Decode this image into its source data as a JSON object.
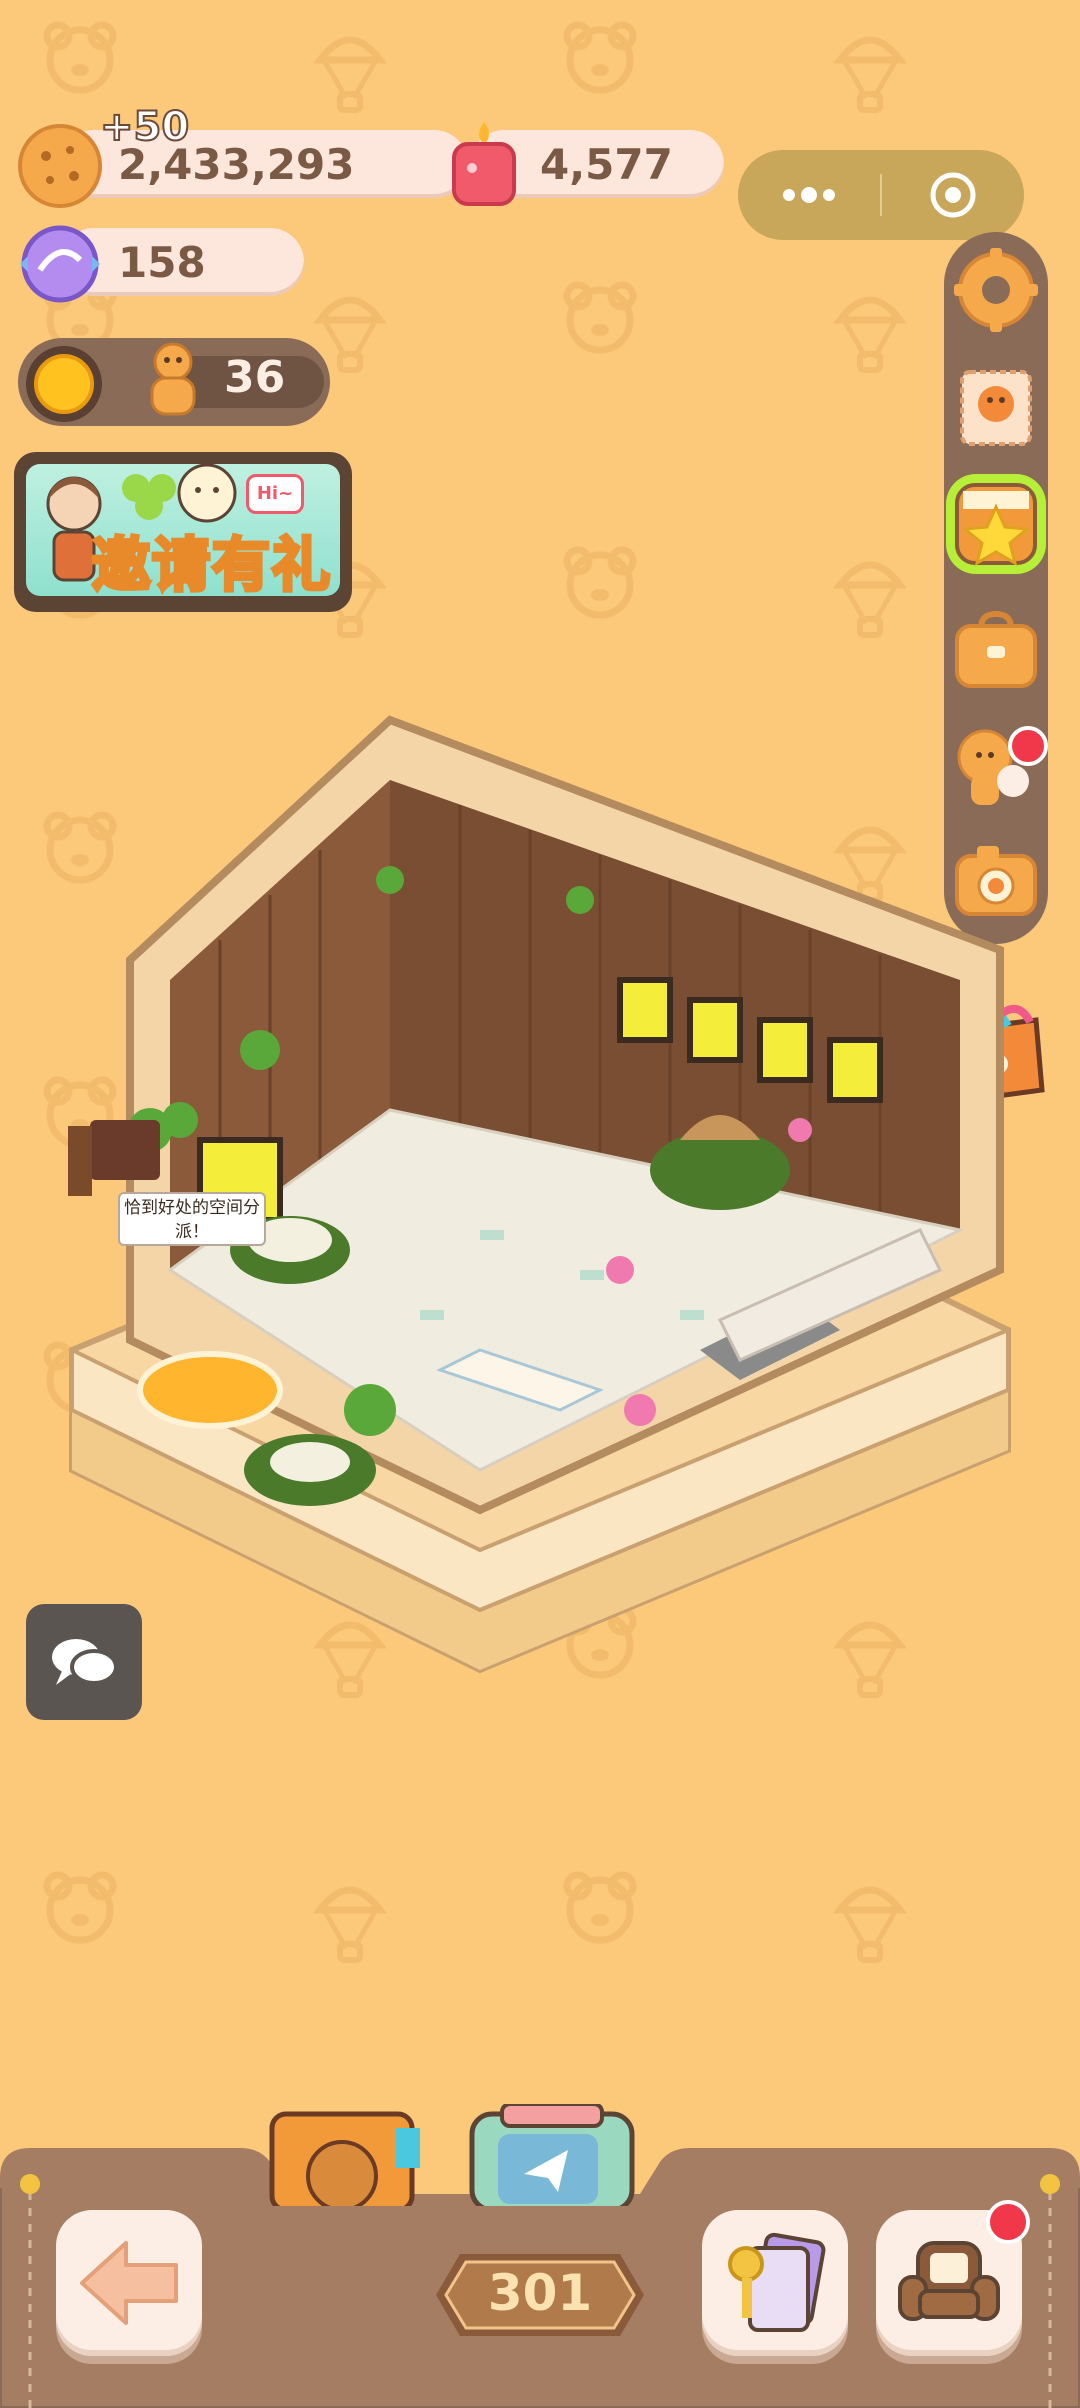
{
  "colors": {
    "background": "#fcc97a",
    "pattern": "#f3bc6c",
    "panel_brown": "#8a6b58",
    "pill_bg": "#fde6dc",
    "text_brown": "#7a5a45",
    "accent_red": "#f0384a"
  },
  "currency": {
    "cookie_amount": "2,433,293",
    "cookie_gain": "+50",
    "candle_amount": "4,577",
    "gem_amount": "158",
    "gingerbread_count": "36"
  },
  "banner": {
    "invite_label": "邀请有礼",
    "invite_badge": "Hi~"
  },
  "room": {
    "speech_bubble": "恰到好处的空间分派！"
  },
  "bottom": {
    "level_number": "301"
  },
  "sidebar": {
    "items": [
      "gear-icon",
      "stamp-card-icon",
      "star-shop-icon",
      "bag-icon",
      "friends-icon",
      "camera-icon"
    ]
  }
}
